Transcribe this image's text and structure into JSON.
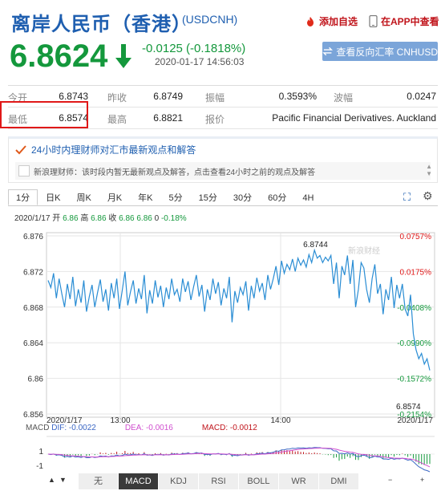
{
  "header": {
    "title": "离岸人民币（香港）",
    "code": "(USDCNH)",
    "add_watch": "添加自选",
    "app_view": "在APP中查看"
  },
  "quote": {
    "price": "6.8624",
    "change": "-0.0125 (-0.1818%)",
    "time": "2020-01-17  14:56:03",
    "reverse_button": "查看反向汇率 CNHUSD"
  },
  "stats": {
    "rows": [
      [
        {
          "label": "今开",
          "value": "6.8743"
        },
        {
          "label": "昨收",
          "value": "6.8749"
        },
        {
          "label": "振幅",
          "value": "0.3593%"
        },
        {
          "label": "波幅",
          "value": "0.0247"
        }
      ],
      [
        {
          "label": "最低",
          "value": "6.8574"
        },
        {
          "label": "最高",
          "value": "6.8821"
        },
        {
          "label": "报价",
          "value": "Pacific Financial Derivatives. Auckland"
        }
      ]
    ]
  },
  "news": {
    "heading": "24小时内理财师对汇市最新观点和解答",
    "body": "新浪理财师：该时段内暂无最新观点及解答，点击查看24小时之前的观点及解答"
  },
  "tabs": [
    "1分",
    "日K",
    "周K",
    "月K",
    "年K",
    "5分",
    "15分",
    "30分",
    "60分",
    "4H"
  ],
  "info_line": {
    "date": "2020/1/17",
    "open_label": "开",
    "open": "6.86",
    "high_label": "高",
    "high": "6.86",
    "close_label": "收",
    "close": "6.86",
    "last_label": "",
    "last": "6.86",
    "vol": "0",
    "pct": "-0.18%"
  },
  "chart_data": {
    "type": "line",
    "title": "",
    "y_ticks": [
      "6.876",
      "6.872",
      "6.868",
      "6.864",
      "6.86",
      "6.856"
    ],
    "ylim": [
      6.856,
      6.876
    ],
    "pct_ticks": [
      "0.0757%",
      "0.0175%",
      "-0.0408%",
      "-0.0990%",
      "-0.1572%",
      "-0.2154%"
    ],
    "x_ticks": [
      "2020/1/17",
      "13:00",
      "14:00",
      "2020/1/17"
    ],
    "annotations": {
      "high": "6.8744",
      "low": "6.8574"
    },
    "watermark": "新浪财经",
    "series": [
      {
        "values": [
          6.871,
          6.8702,
          6.8718,
          6.869,
          6.8712,
          6.8695,
          6.868,
          6.8706,
          6.8689,
          6.8714,
          6.8681,
          6.87,
          6.8685,
          6.871,
          6.8675,
          6.8692,
          6.8705,
          6.868,
          6.8696,
          6.8711,
          6.8686,
          6.87,
          6.8676,
          6.8707,
          6.869,
          6.8712,
          6.8678,
          6.8699,
          6.872,
          6.8682,
          6.8697,
          6.871,
          6.8684,
          6.8701,
          6.8689,
          6.8716,
          6.8673,
          6.8699,
          6.8684,
          6.871,
          6.8691,
          6.8704,
          6.868,
          6.8702,
          6.8689,
          6.8712,
          6.8694,
          6.87,
          6.8686,
          6.8712,
          6.8697,
          6.8709,
          6.8688,
          6.8703,
          6.8716,
          6.8692,
          6.8705,
          6.8675,
          6.87,
          6.8688,
          6.8712,
          6.8695,
          6.8708,
          6.8682,
          6.8701,
          6.869,
          6.8714,
          6.8663,
          6.8698,
          6.8685,
          6.8702,
          6.8694,
          6.8709,
          6.8676,
          6.8704,
          6.869,
          6.8713,
          6.8698,
          6.8707,
          6.8688,
          6.8716,
          6.87,
          6.8712,
          6.8726,
          6.8705,
          6.8732,
          6.8718,
          6.8728,
          6.8722,
          6.8734,
          6.872,
          6.8735,
          6.8727,
          6.8733,
          6.8725,
          6.8739,
          6.873,
          6.8744,
          6.8735,
          6.8738,
          6.873,
          6.8736,
          6.8732,
          6.8738,
          6.8706,
          6.873,
          6.869,
          6.8726,
          6.8716,
          6.8738,
          6.8706,
          6.8733,
          6.868,
          6.87,
          6.873,
          6.8724,
          6.87,
          6.8685,
          6.8712,
          6.8728,
          6.8695,
          6.8706,
          6.8672,
          6.87,
          6.8688,
          6.8714,
          6.8679,
          6.8705,
          6.869,
          6.8706,
          6.8678,
          6.867,
          6.8694,
          6.865,
          6.8632,
          6.8622,
          6.8628,
          6.8616,
          6.8622,
          6.8609
        ]
      }
    ]
  },
  "macd": {
    "dif_label": "MACD",
    "dif": "DIF: -0.0022",
    "dea": "DEA: -0.0016",
    "macd": "MACD: -0.0012",
    "y_ticks": [
      "1",
      "-1"
    ],
    "dif_color": "#3b67c4",
    "dea_color": "#d04fcf",
    "macd_color": "#c0141b"
  },
  "bottom_tabs": [
    "无",
    "MACD",
    "KDJ",
    "RSI",
    "BOLL",
    "WR",
    "DMI"
  ],
  "colors": {
    "up": "#14983c",
    "down_red": "#c0141b",
    "accent": "#1f5fb0",
    "line": "#2a8dd4"
  }
}
